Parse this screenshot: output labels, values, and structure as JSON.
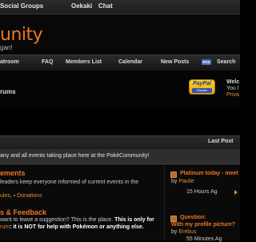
{
  "topnav": {
    "items": [
      "Social Groups",
      "Oekaki",
      "Chat"
    ]
  },
  "header": {
    "logo_text": "unity",
    "tagline": "gan!"
  },
  "navbar": {
    "items": [
      "atroom",
      "FAQ",
      "Members List",
      "Calendar",
      "New Posts",
      "Search"
    ],
    "rss_badge": "RSS"
  },
  "info": {
    "forums_text": "rums",
    "paypal_label": "PayPal",
    "paypal_donate": "Donate",
    "welcome": "Welc",
    "you_line": "You l",
    "privacy_line": "Priva"
  },
  "table": {
    "last_post_header": "Last Post",
    "category_desc": "any and all events taking place here at the PokéCommunity!"
  },
  "forums": [
    {
      "title": "ements",
      "desc": "leaders keep everyone informed of current events in the",
      "links": {
        "a": "ules",
        "sep": ",",
        "b": "Donations"
      },
      "last_post": {
        "title": "Platinum today - meet",
        "by": "by",
        "user": "Paulie",
        "time": "15 Hours Ag"
      }
    },
    {
      "title": "s & Feedback",
      "desc_1_pre": "want to leave a suggestion? This is the place. ",
      "desc_1_bold": "This is only for",
      "desc_2_link": "rum",
      "desc_2_rest": ": it is NOT for help with Pokémon or anything else.",
      "last_post": {
        "title": "Question:",
        "title2": "With my profile picture?",
        "by": "by",
        "user": "Erebus",
        "time": "55 Minutes Ag"
      }
    }
  ],
  "colors": {
    "accent": "#ee7722",
    "link": "#e8892f",
    "background": "#000000"
  }
}
